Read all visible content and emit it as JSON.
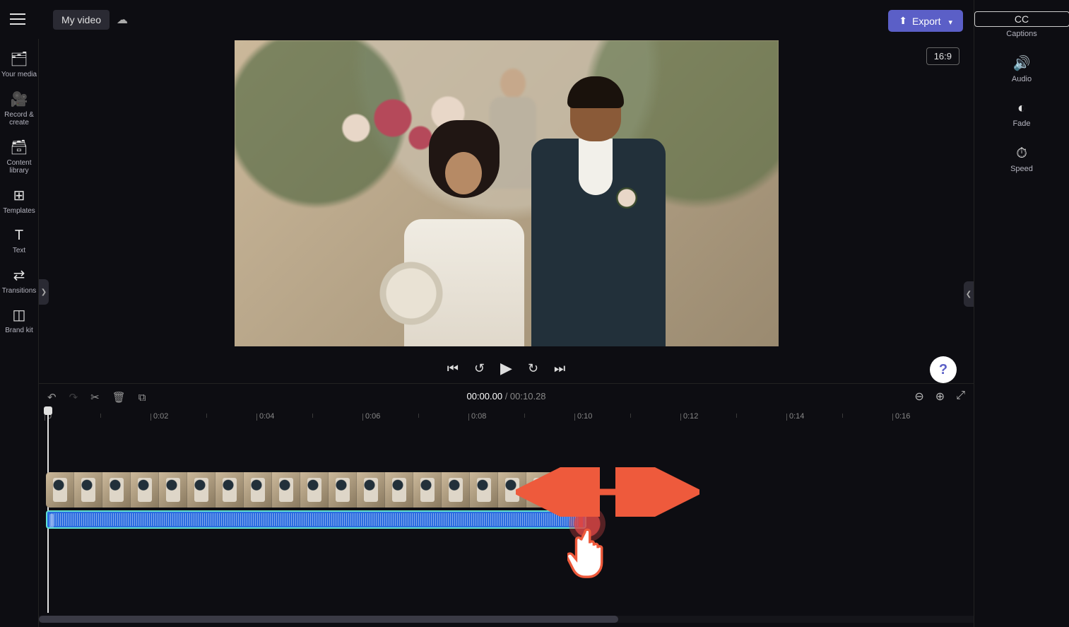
{
  "title": "My video",
  "export_label": "Export",
  "aspect_ratio": "16:9",
  "left_sidebar": [
    {
      "icon": "🗂",
      "label": "Your media"
    },
    {
      "icon": "🎥",
      "label": "Record & create"
    },
    {
      "icon": "🗃",
      "label": "Content library"
    },
    {
      "icon": "⊞",
      "label": "Templates"
    },
    {
      "icon": "T",
      "label": "Text"
    },
    {
      "icon": "⇄",
      "label": "Transitions"
    },
    {
      "icon": "◫",
      "label": "Brand kit"
    }
  ],
  "right_sidebar": [
    {
      "icon": "CC",
      "label": "Captions"
    },
    {
      "icon": "🔊",
      "label": "Audio"
    },
    {
      "icon": "◐",
      "label": "Fade"
    },
    {
      "icon": "⏱",
      "label": "Speed"
    }
  ],
  "playback": {
    "current_time": "00:00.00",
    "total_time": "00:10.28"
  },
  "ruler_ticks": [
    "0",
    "0:02",
    "0:04",
    "0:06",
    "0:08",
    "0:10",
    "0:12",
    "0:14",
    "0:16"
  ],
  "help_glyph": "?"
}
